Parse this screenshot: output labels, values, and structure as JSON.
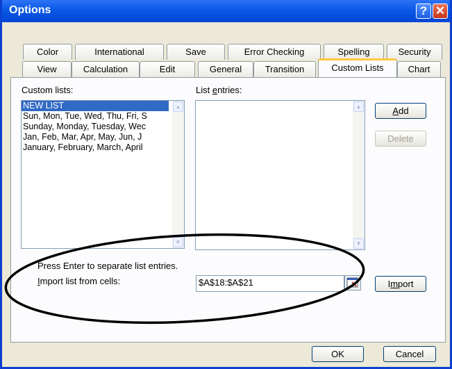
{
  "window": {
    "title": "Options"
  },
  "tabs_row1": [
    "Color",
    "International",
    "Save",
    "Error Checking",
    "Spelling",
    "Security"
  ],
  "tabs_row2": [
    "View",
    "Calculation",
    "Edit",
    "General",
    "Transition",
    "Custom Lists",
    "Chart"
  ],
  "custom_lists": {
    "label": "Custom lists:",
    "items": [
      "NEW LIST",
      "Sun, Mon, Tue, Wed, Thu, Fri, S",
      "Sunday, Monday, Tuesday, Wec",
      "Jan, Feb, Mar, Apr, May, Jun, J",
      "January, February, March, April"
    ]
  },
  "list_entries": {
    "label_pre": "List ",
    "label_u": "e",
    "label_post": "ntries:"
  },
  "buttons": {
    "add_u": "A",
    "add_rest": "dd",
    "delete": "Delete",
    "import_pre": "I",
    "import_u": "m",
    "import_post": "port",
    "ok": "OK",
    "cancel": "Cancel"
  },
  "hint": "Press Enter to separate list entries.",
  "import_label": {
    "pre": "",
    "u": "I",
    "post": "mport list from cells:"
  },
  "import_range": "$A$18:$A$21"
}
